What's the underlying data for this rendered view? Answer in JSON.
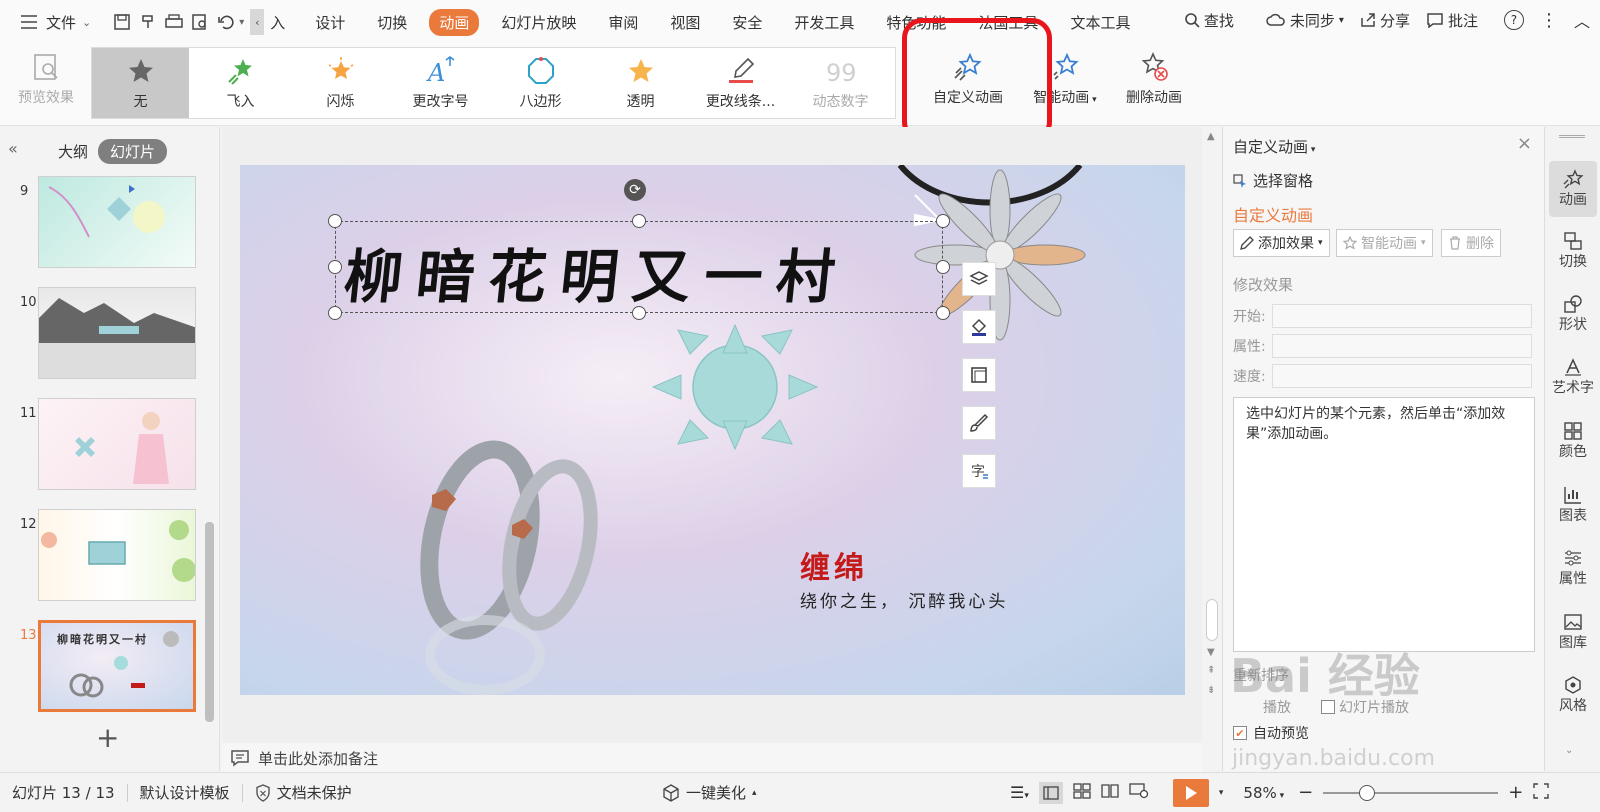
{
  "menu": {
    "file_label": "文件",
    "input_label": "入",
    "tabs": [
      {
        "label": "设计"
      },
      {
        "label": "切换"
      },
      {
        "label": "动画"
      },
      {
        "label": "幻灯片放映"
      },
      {
        "label": "审阅"
      },
      {
        "label": "视图"
      },
      {
        "label": "安全"
      },
      {
        "label": "开发工具"
      },
      {
        "label": "特色功能"
      },
      {
        "label": "法国工具"
      },
      {
        "label": "文本工具"
      }
    ],
    "search_label": "查找",
    "sync_label": "未同步",
    "share_label": "分享",
    "comment_label": "批注"
  },
  "ribbon": {
    "preview_label": "预览效果",
    "gallery": [
      {
        "label": "无"
      },
      {
        "label": "飞入"
      },
      {
        "label": "闪烁"
      },
      {
        "label": "更改字号"
      },
      {
        "label": "八边形"
      },
      {
        "label": "透明"
      },
      {
        "label": "更改线条..."
      },
      {
        "label": "动态数字"
      }
    ],
    "custom_anim_label": "自定义动画",
    "smart_anim_label": "智能动画",
    "delete_anim_label": "删除动画"
  },
  "left_panel": {
    "outline_tab": "大纲",
    "slides_tab": "幻灯片",
    "thumbnails": [
      {
        "num": "9"
      },
      {
        "num": "10"
      },
      {
        "num": "11"
      },
      {
        "num": "12"
      },
      {
        "num": "13",
        "title": "柳暗花明又一村"
      }
    ]
  },
  "slide": {
    "title": "柳暗花明又一村",
    "subtitle": "缠绵",
    "tagline": "绕你之生， 沉醉我心头"
  },
  "notes_placeholder": "单击此处添加备注",
  "right_panel": {
    "title": "自定义动画",
    "select_pane": "选择窗格",
    "section_title": "自定义动画",
    "add_effect": "添加效果",
    "smart_anim": "智能动画",
    "delete": "删除",
    "modify_title": "修改效果",
    "start_label": "开始:",
    "property_label": "属性:",
    "speed_label": "速度:",
    "hint": "选中幻灯片的某个元素，然后单击“添加效果”添加动画。",
    "reorder_label": "重新排序",
    "play_label": "播放",
    "slideshow_label": "幻灯片播放",
    "auto_preview": "自动预览"
  },
  "side_tools": [
    {
      "label": "动画"
    },
    {
      "label": "切换"
    },
    {
      "label": "形状"
    },
    {
      "label": "艺术字"
    },
    {
      "label": "颜色"
    },
    {
      "label": "图表"
    },
    {
      "label": "属性"
    },
    {
      "label": "图库"
    },
    {
      "label": "风格"
    }
  ],
  "status": {
    "slide_info": "幻灯片 13 / 13",
    "template": "默认设计模板",
    "protect": "文档未保护",
    "beautify": "一键美化",
    "zoom": "58%"
  },
  "watermark": {
    "brand": "Bai 经验",
    "url": "jingyan.baidu.com"
  },
  "colors": {
    "accent": "#e97a3c",
    "highlight": "#e8161c"
  }
}
